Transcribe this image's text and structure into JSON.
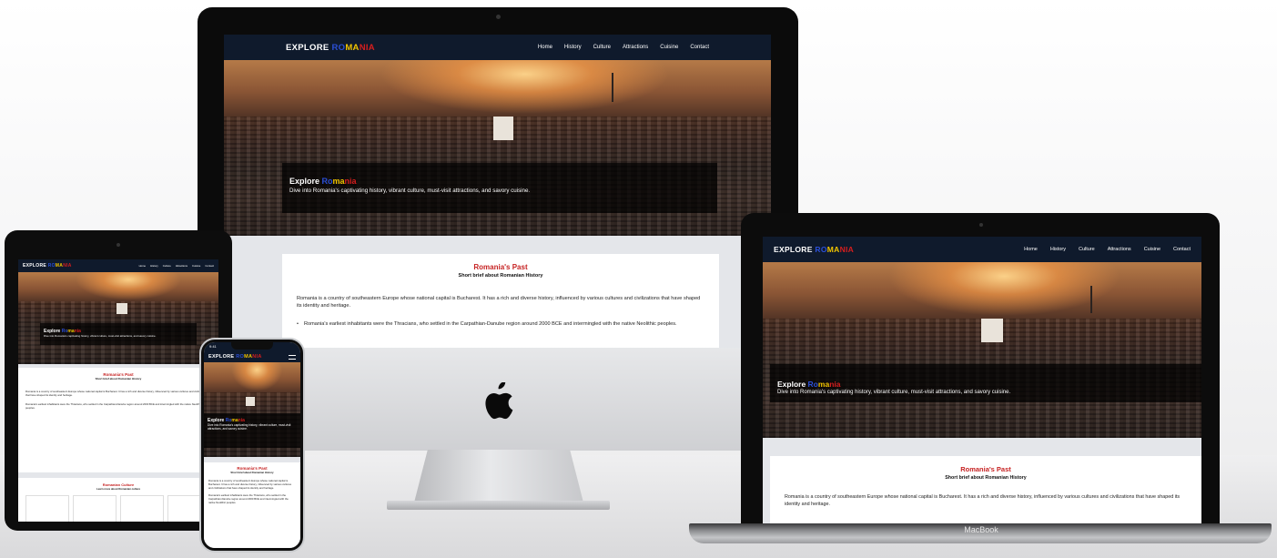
{
  "site": {
    "brand_prefix": "EXPLORE ",
    "brand_r1": "RO",
    "brand_r2": "MA",
    "brand_r3": "NIA",
    "nav": [
      "Home",
      "History",
      "Culture",
      "Attractions",
      "Cuisine",
      "Contact"
    ],
    "hero_title_prefix": "Explore ",
    "hero_title_r1": "Ro",
    "hero_title_r2": "ma",
    "hero_title_r3": "nia",
    "hero_subtitle": "Dive into Romania's captivating history, vibrant culture, must-visit attractions, and savory cuisine.",
    "section_title": "Romania's Past",
    "section_subtitle": "Short brief about Romanian History",
    "intro": "Romania is a country of southeastern Europe whose national capital is Bucharest. It has a rich and diverse history, influenced by various cultures and civilizations that have shaped its identity and heritage.",
    "bullet1": "Romania's earliest inhabitants were the Thracians, who settled in the Carpathian-Danube region around 2000 BCE and intermingled with the native Neolithic peoples.",
    "culture_title": "Romanian Culture",
    "culture_subtitle": "Learn more about Romanian culture"
  },
  "devices": {
    "laptop_label": "MacBook",
    "phone_time": "9:41"
  },
  "colors": {
    "navbar": "#0f1a2c",
    "blue": "#2b4fd6",
    "yellow": "#f2c500",
    "red": "#d61e1e",
    "section_title": "#c62222"
  }
}
